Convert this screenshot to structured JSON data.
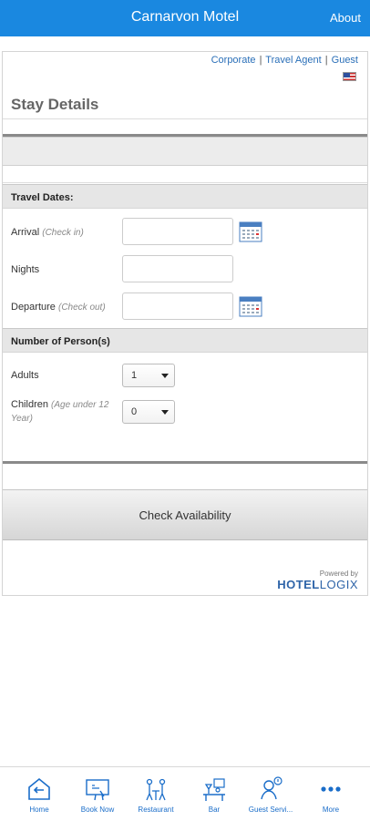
{
  "topbar": {
    "title": "Carnarvon Motel",
    "about": "About"
  },
  "user_links": {
    "corporate": "Corporate",
    "travel_agent": "Travel Agent",
    "guest": "Guest",
    "separator": "|"
  },
  "heading": "Stay Details",
  "travel": {
    "section_title": "Travel Dates:",
    "arrival_label": "Arrival",
    "arrival_hint": "(Check in)",
    "arrival_value": "",
    "nights_label": "Nights",
    "nights_value": "",
    "departure_label": "Departure",
    "departure_hint": "(Check out)",
    "departure_value": ""
  },
  "persons": {
    "section_title": "Number of Person(s)",
    "adults_label": "Adults",
    "adults_value": "1",
    "children_label": "Children",
    "children_hint": "(Age under 12 Year)",
    "children_value": "0"
  },
  "check_button": "Check Availability",
  "powered": {
    "small": "Powered by",
    "brand_a": "HOTEL",
    "brand_b": "LOGIX"
  },
  "tabs": [
    {
      "label": "Home",
      "icon": "home-icon"
    },
    {
      "label": "Book Now",
      "icon": "book-icon"
    },
    {
      "label": "Restaurant",
      "icon": "restaurant-icon"
    },
    {
      "label": "Bar",
      "icon": "bar-icon"
    },
    {
      "label": "Guest Servi...",
      "icon": "guest-service-icon"
    },
    {
      "label": "More",
      "icon": "more-icon"
    }
  ],
  "colors": {
    "brand": "#1a88e0",
    "link": "#2a6fb8",
    "tab": "#1a6dc9"
  }
}
